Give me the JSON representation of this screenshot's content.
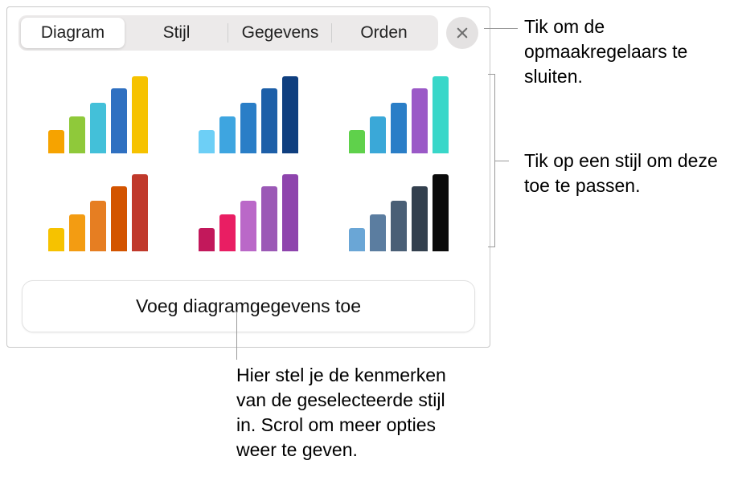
{
  "tabs": {
    "diagram": "Diagram",
    "stijl": "Stijl",
    "gegevens": "Gegevens",
    "orden": "Orden"
  },
  "styles": [
    {
      "colors": [
        "#f6a300",
        "#8fc93a",
        "#43c0d9",
        "#2f70c1",
        "#f6c200"
      ]
    },
    {
      "colors": [
        "#6dcff6",
        "#3ea5e0",
        "#2a7ec7",
        "#1d5fa8",
        "#0f3f7f"
      ]
    },
    {
      "colors": [
        "#5fd14b",
        "#3aa8d8",
        "#2a7ec7",
        "#9b59c7",
        "#39d7c9"
      ]
    },
    {
      "colors": [
        "#f6c200",
        "#f39c12",
        "#e67e22",
        "#d35400",
        "#c0392b"
      ]
    },
    {
      "colors": [
        "#c2185b",
        "#e91e63",
        "#ba68c8",
        "#9b59b6",
        "#8e44ad"
      ]
    },
    {
      "colors": [
        "#6aa6d6",
        "#5b7da0",
        "#4a5f76",
        "#33404e",
        "#0b0b0b"
      ]
    }
  ],
  "action_button": "Voeg diagramgegevens toe",
  "callouts": {
    "close": "Tik om de opmaakregelaars te sluiten.",
    "style": "Tik op een stijl om deze toe te passen.",
    "button": "Hier stel je de kenmerken van de geselecteerde stijl in. Scrol om meer opties weer te geven."
  }
}
